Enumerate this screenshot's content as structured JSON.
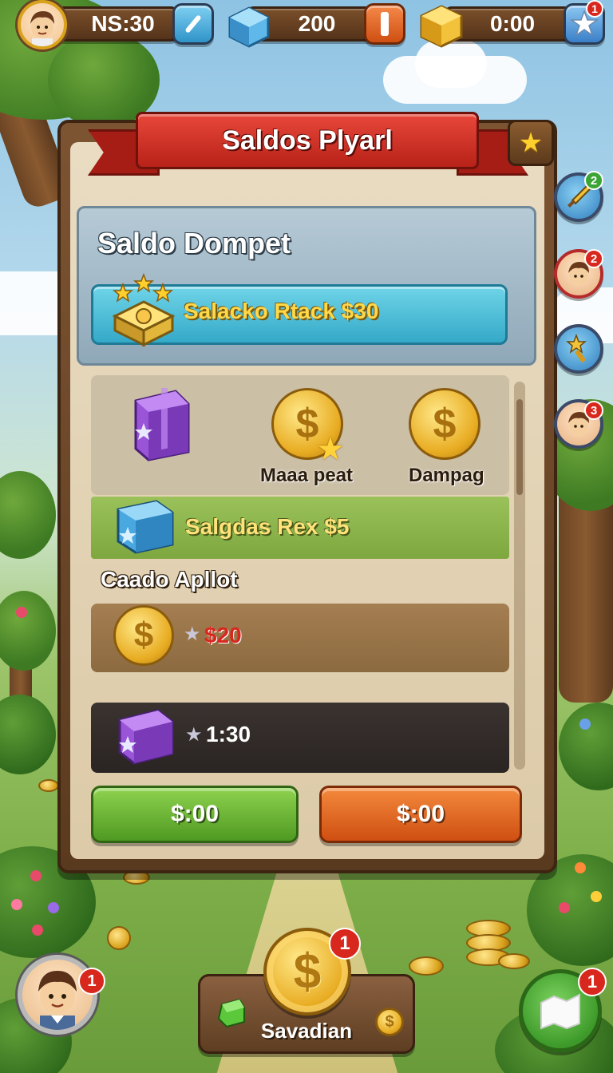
{
  "topbar": {
    "resource_1": "NS:30",
    "resource_2": "200",
    "resource_3": "0:00",
    "star_badge": "1",
    "icons": [
      "avatar-icon",
      "pencil-icon",
      "blue-gem-icon",
      "orange-pause-icon",
      "gold-cube-icon",
      "star-icon"
    ]
  },
  "panel": {
    "title": "Saldos Plyarl",
    "wallet_title": "Saldo Dompet",
    "wallet_bar": "Salacko Rtack $30",
    "items": [
      {
        "label": "",
        "icon": "purple-box-icon"
      },
      {
        "label": "Maaa peat",
        "icon": "gold-coin-icon"
      },
      {
        "label": "Dampag",
        "icon": "gold-coin-icon"
      }
    ],
    "green_row": "Salgdas Rex $5",
    "section_label": "Caado Apllot",
    "rows": [
      {
        "value": "$20",
        "icon": "gold-coin-icon",
        "color": "#d8281e"
      },
      {
        "value": "1:30",
        "icon": "purple-box-icon",
        "color": "#ffffff"
      }
    ],
    "buttons": {
      "green": "$:00",
      "orange": "$:00"
    }
  },
  "side": {
    "badges": [
      "2",
      "2",
      "",
      "3"
    ],
    "icons": [
      "sword-icon",
      "avatar-icon",
      "star-sword-icon",
      "avatar-icon"
    ]
  },
  "bottom": {
    "avatar_badge": "1",
    "center_badge": "1",
    "center_label": "Savadian",
    "right_badge": "1"
  },
  "colors": {
    "ribbon": "#c22b20",
    "wallet_bar": "#4fc0dc",
    "green_button": "#5fae2e",
    "orange_button": "#e0651e",
    "gold_text": "#ffd84a"
  }
}
